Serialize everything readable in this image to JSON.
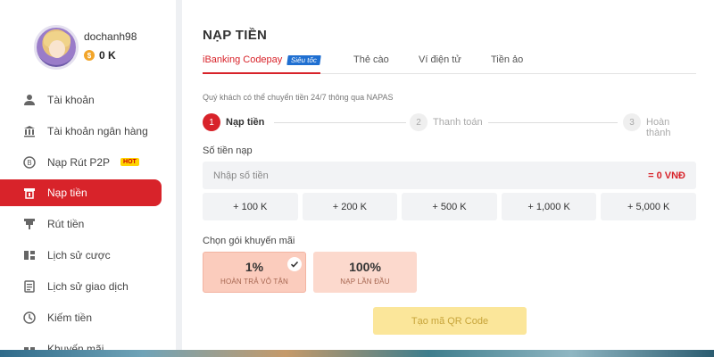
{
  "profile": {
    "username": "dochanh98",
    "balance": "0 K",
    "coin_symbol": "$"
  },
  "sidebar": {
    "items": [
      {
        "label": "Tài khoản",
        "icon": "user-icon",
        "glyph": "👤"
      },
      {
        "label": "Tài khoản ngân hàng",
        "icon": "bank-icon",
        "glyph": "🏛"
      },
      {
        "label": "Nạp Rút P2P",
        "icon": "p2p-icon",
        "glyph": "₿",
        "badge": "HOT"
      },
      {
        "label": "Nạp tiền",
        "icon": "deposit-icon",
        "glyph": "🗂",
        "active": true
      },
      {
        "label": "Rút tiền",
        "icon": "withdraw-icon",
        "glyph": "⛾"
      },
      {
        "label": "Lịch sử cược",
        "icon": "bet-history-icon",
        "glyph": "⫶"
      },
      {
        "label": "Lịch sử giao dịch",
        "icon": "transaction-history-icon",
        "glyph": "🗒"
      },
      {
        "label": "Kiếm tiền",
        "icon": "earn-icon",
        "glyph": "◔"
      },
      {
        "label": "Khuyến mãi",
        "icon": "gift-icon",
        "glyph": "🎁"
      }
    ]
  },
  "main": {
    "title": "NẠP TIỀN",
    "tabs": [
      {
        "label": "iBanking Codepay",
        "badge": "Siêu tốc",
        "active": true
      },
      {
        "label": "Thẻ cào"
      },
      {
        "label": "Ví điện tử"
      },
      {
        "label": "Tiền ảo"
      }
    ],
    "note": "Quý khách có thể chuyển tiền 24/7 thông qua NAPAS",
    "steps": [
      {
        "num": "1",
        "label": "Nạp tiền"
      },
      {
        "num": "2",
        "label": "Thanh toán"
      },
      {
        "num": "3",
        "label": "Hoàn thành"
      }
    ],
    "amount_label": "Số tiền nạp",
    "amount_placeholder": "Nhập số tiền",
    "amount_value": "",
    "amount_equiv": "= 0 VNĐ",
    "presets": [
      "+ 100 K",
      "+ 200 K",
      "+ 500 K",
      "+ 1,000 K",
      "+ 5,000 K"
    ],
    "promo_label": "Chọn gói khuyến mãi",
    "promos": [
      {
        "pct": "1%",
        "desc": "HOÀN TRẢ VÔ TẬN",
        "selected": true
      },
      {
        "pct": "100%",
        "desc": "NẠP LẦN ĐẦU"
      }
    ],
    "qr_button": "Tạo mã QR Code"
  },
  "colors": {
    "accent": "#d8232a",
    "badge_blue": "#1f6fd1",
    "button_disabled": "#fbe69a",
    "promo_bg": "#fcd9cd"
  }
}
